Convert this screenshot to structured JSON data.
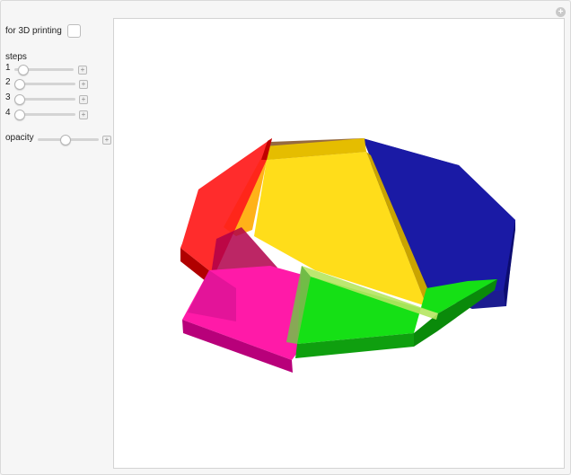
{
  "controls": {
    "print_label": "for 3D printing",
    "print_checked": false,
    "steps_heading": "steps",
    "sliders": [
      {
        "label": "1",
        "value": 0.05
      },
      {
        "label": "2",
        "value": 0.0
      },
      {
        "label": "3",
        "value": 0.0
      },
      {
        "label": "4",
        "value": 0.0
      }
    ],
    "opacity": {
      "label": "opacity",
      "value": 0.55
    }
  },
  "icons": {
    "corner": "plus-circle-icon",
    "slider_increment": "plus-square-icon"
  },
  "colors": {
    "yellow": "#ffdd1a",
    "blue": "#1a1aa6",
    "green": "#15e015",
    "magenta": "#ff1aa8",
    "red": "#ff1a1a",
    "orange": "#ffaa00",
    "brown": "#8b5a2b"
  }
}
